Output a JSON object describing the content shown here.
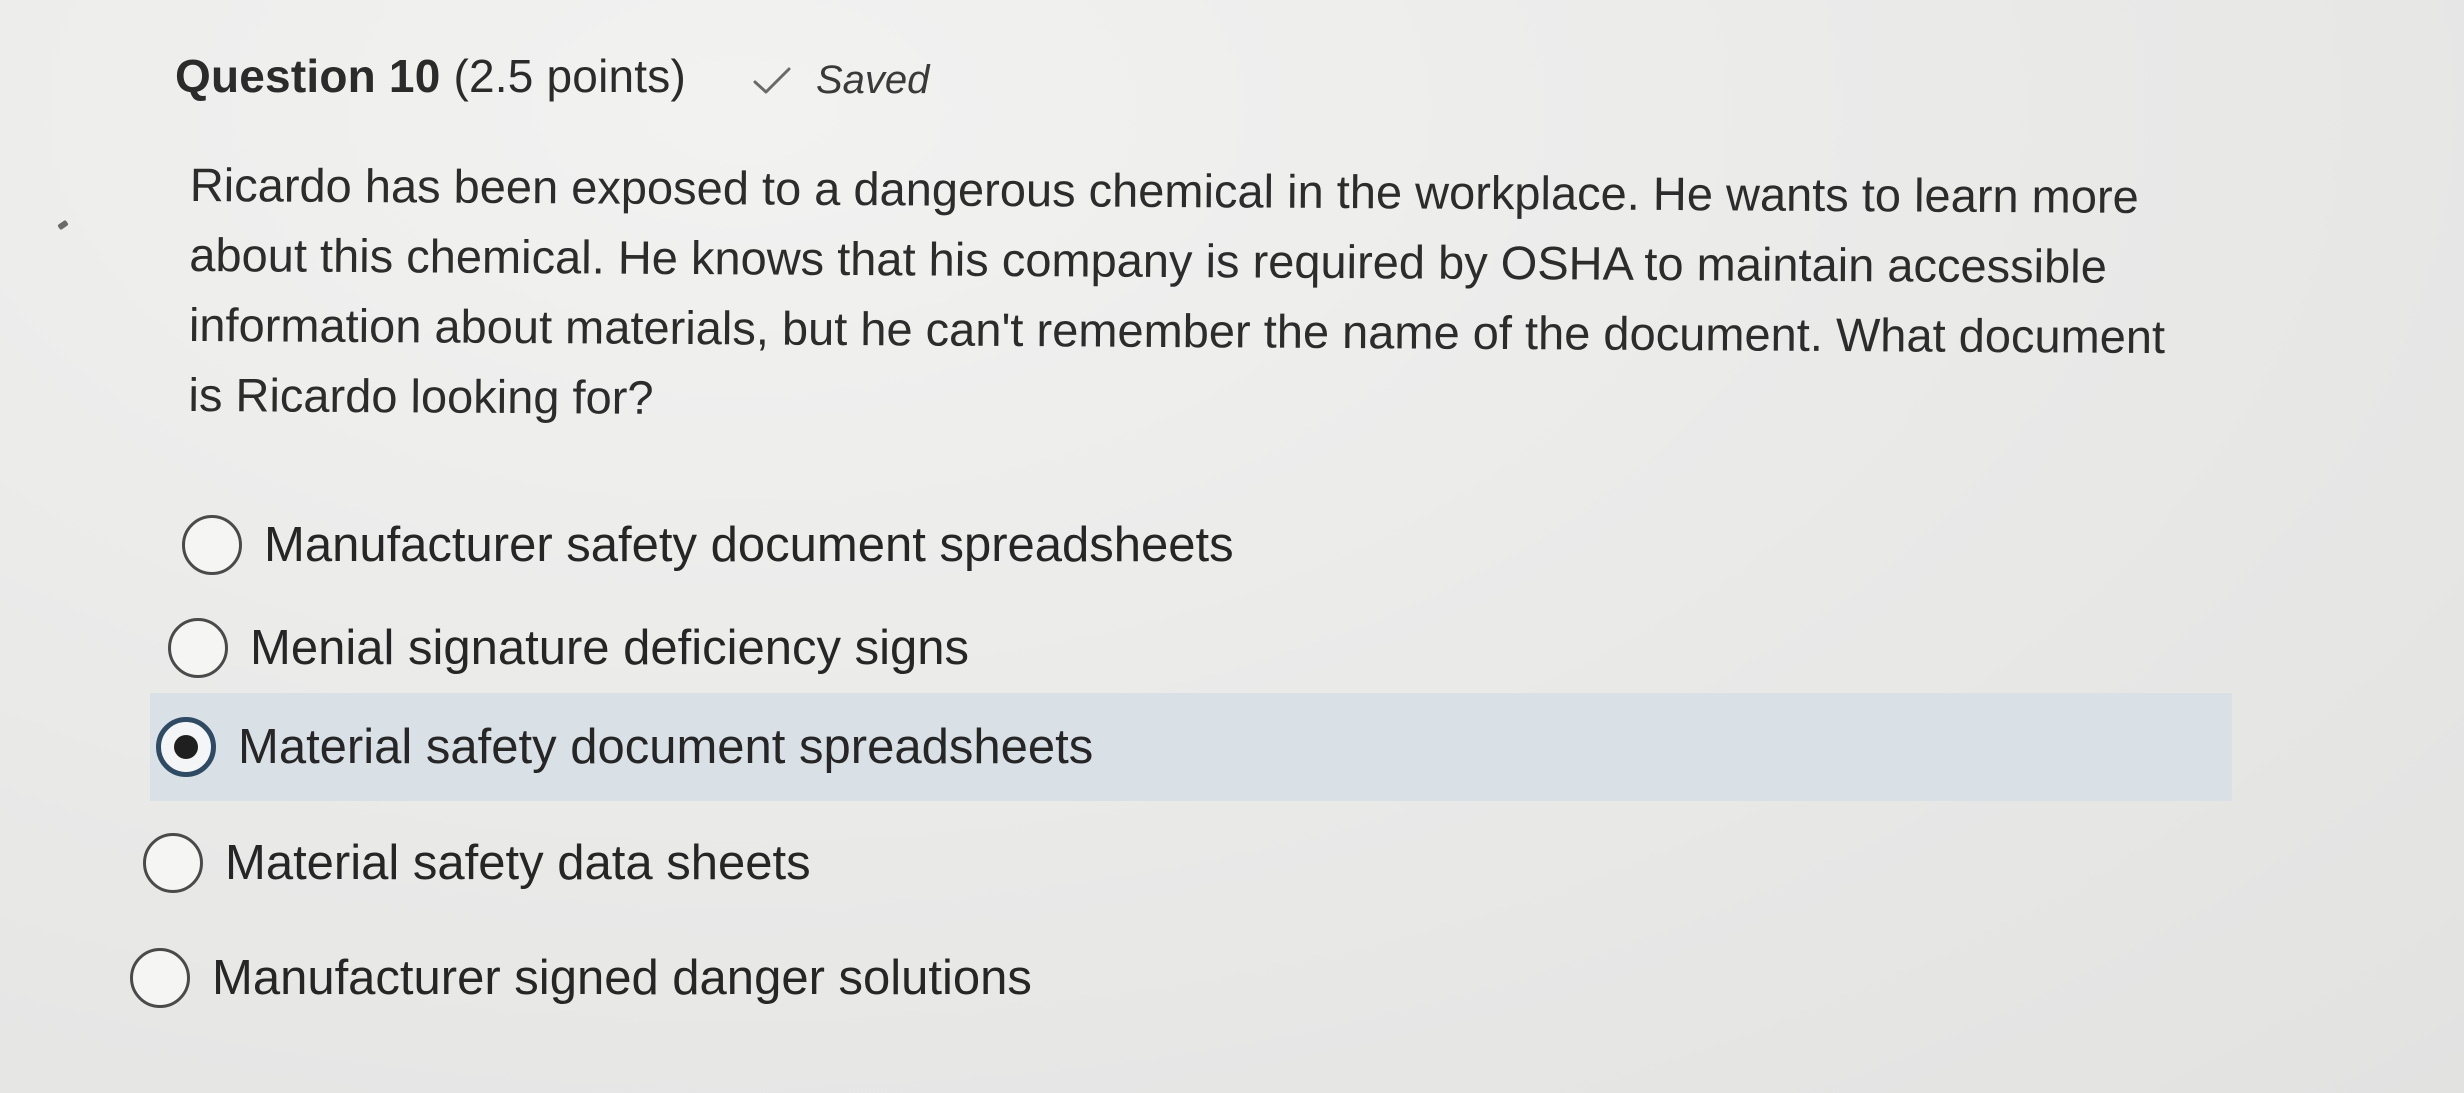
{
  "question": {
    "number_label": "Question 10",
    "points_label": "(2.5 points)",
    "status_icon": "check-icon",
    "status_text": "Saved",
    "prompt": "Ricardo has been exposed to a dangerous chemical in the workplace. He wants to learn more about this chemical. He knows that his company is required by OSHA to maintain accessible information about materials, but he can't remember the name of the document. What document is Ricardo looking for?"
  },
  "options": [
    {
      "label": "Manufacturer safety document spreadsheets",
      "selected": false
    },
    {
      "label": "Menial signature deficiency signs",
      "selected": false
    },
    {
      "label": "Material safety document spreadsheets",
      "selected": true
    },
    {
      "label": "Material safety data sheets",
      "selected": false
    },
    {
      "label": "Manufacturer signed danger solutions",
      "selected": false
    }
  ],
  "colors": {
    "selected_row_bg": "#d9e0e6",
    "text": "#2b2b2b",
    "selected_ring": "#2f4a63"
  }
}
